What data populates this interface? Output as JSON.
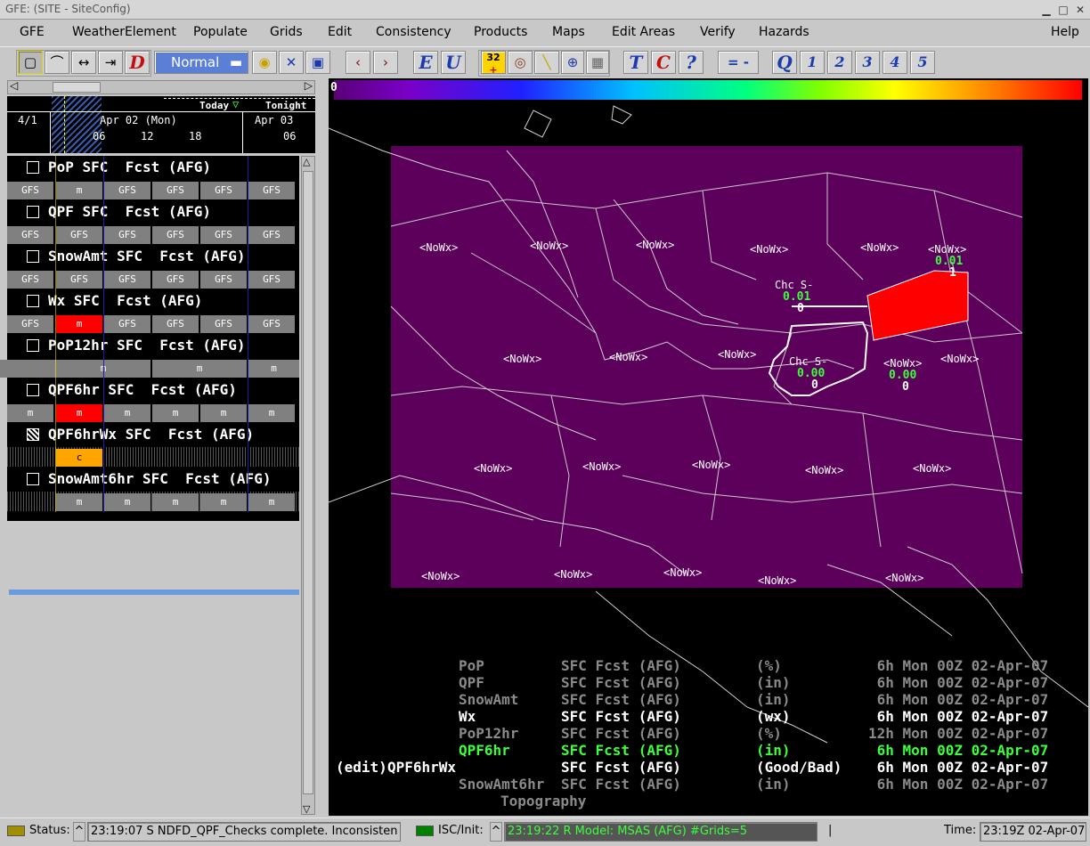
{
  "window": {
    "title": "GFE: (SITE - SiteConfig)"
  },
  "menu": [
    "GFE",
    "WeatherElement",
    "Populate",
    "Grids",
    "Edit",
    "Consistency",
    "Products",
    "Maps",
    "Edit Areas",
    "Verify",
    "Hazards",
    "Help"
  ],
  "toolbar": {
    "edit_mode": "Normal",
    "badge_value": "32",
    "letters": [
      "E",
      "U",
      "T",
      "C",
      "?",
      "Q"
    ],
    "numbers": [
      "1",
      "2",
      "3",
      "4",
      "5"
    ],
    "eq_label": "= -"
  },
  "timescale": {
    "left_date": "4/1",
    "date1": "Apr 02 (Mon)",
    "date2": "Apr 03",
    "today": "Today",
    "tonight": "Tonight",
    "ticks": [
      "06",
      "12",
      "18",
      "06"
    ]
  },
  "grids": [
    {
      "name": "PoP SFC  Fcst (AFG)",
      "cells": [
        "GFS",
        "m",
        "GFS",
        "GFS",
        "GFS",
        "GFS"
      ]
    },
    {
      "name": "QPF SFC  Fcst (AFG)",
      "cells": [
        "GFS",
        "GFS",
        "GFS",
        "GFS",
        "GFS",
        "GFS"
      ]
    },
    {
      "name": "SnowAmt SFC  Fcst (AFG)",
      "cells": [
        "GFS",
        "GFS",
        "GFS",
        "GFS",
        "GFS",
        "GFS"
      ]
    },
    {
      "name": "Wx SFC  Fcst (AFG)",
      "cells": [
        "GFS",
        "m",
        "GFS",
        "GFS",
        "GFS",
        "GFS"
      ]
    },
    {
      "name": "PoP12hr SFC  Fcst (AFG)",
      "cells": [
        "m",
        "m",
        "m"
      ]
    },
    {
      "name": "QPF6hr SFC  Fcst (AFG)",
      "cells": [
        "m",
        "m",
        "m",
        "m",
        "m",
        "m"
      ]
    },
    {
      "name": "QPF6hrWx SFC  Fcst (AFG)",
      "cells": [
        "c"
      ]
    },
    {
      "name": "SnowAmt6hr SFC  Fcst (AFG)",
      "cells": [
        "m",
        "m",
        "m",
        "m",
        "m"
      ]
    }
  ],
  "colorbar": {
    "min_label": "0"
  },
  "map": {
    "nowx": "<NoWx>",
    "chc_label": "Chc S-",
    "values": [
      "0.01",
      "0.01",
      "0.00",
      "0.00"
    ],
    "zeros": [
      "1",
      "0",
      "0",
      "0"
    ],
    "area_fill": "#5c005c",
    "highlight_fill": "#ff0000"
  },
  "legend": [
    {
      "prefix": "",
      "name": "PoP",
      "level": "SFC Fcst (AFG)",
      "units": "(%)",
      "time": " 6h Mon 00Z 02-Apr-07",
      "color": "#8a8a8a"
    },
    {
      "prefix": "",
      "name": "QPF",
      "level": "SFC Fcst (AFG)",
      "units": "(in)",
      "time": " 6h Mon 00Z 02-Apr-07",
      "color": "#8a8a8a"
    },
    {
      "prefix": "",
      "name": "SnowAmt",
      "level": "SFC Fcst (AFG)",
      "units": "(in)",
      "time": " 6h Mon 00Z 02-Apr-07",
      "color": "#8a8a8a"
    },
    {
      "prefix": "",
      "name": "Wx",
      "level": "SFC Fcst (AFG)",
      "units": "(wx)",
      "time": " 6h Mon 00Z 02-Apr-07",
      "color": "#ffffff"
    },
    {
      "prefix": "",
      "name": "PoP12hr",
      "level": "SFC Fcst (AFG)",
      "units": "(%)",
      "time": "12h Mon 00Z 02-Apr-07",
      "color": "#8a8a8a"
    },
    {
      "prefix": "",
      "name": "QPF6hr",
      "level": "SFC Fcst (AFG)",
      "units": "(in)",
      "time": " 6h Mon 00Z 02-Apr-07",
      "color": "#3cff3c"
    },
    {
      "prefix": "(edit)",
      "name": "QPF6hrWx",
      "level": "SFC Fcst (AFG)",
      "units": "(Good/Bad)",
      "time": " 6h Mon 00Z 02-Apr-07",
      "color": "#ffffff"
    },
    {
      "prefix": "",
      "name": "SnowAmt6hr",
      "level": "SFC Fcst (AFG)",
      "units": "(in)",
      "time": " 6h Mon 00Z 02-Apr-07",
      "color": "#8a8a8a"
    },
    {
      "prefix": "",
      "name": "Topography",
      "level": "",
      "units": "",
      "time": "",
      "color": "#8a8a8a"
    }
  ],
  "status": {
    "status_label": "Status:",
    "status_text": "23:19:07 S NDFD_QPF_Checks complete. Inconsisten",
    "isc_label": "ISC/Init:",
    "isc_text": "23:19:22 R Model: MSAS (AFG) #Grids=5",
    "time_label": "Time:",
    "time_text": "23:19Z 02-Apr-07"
  }
}
